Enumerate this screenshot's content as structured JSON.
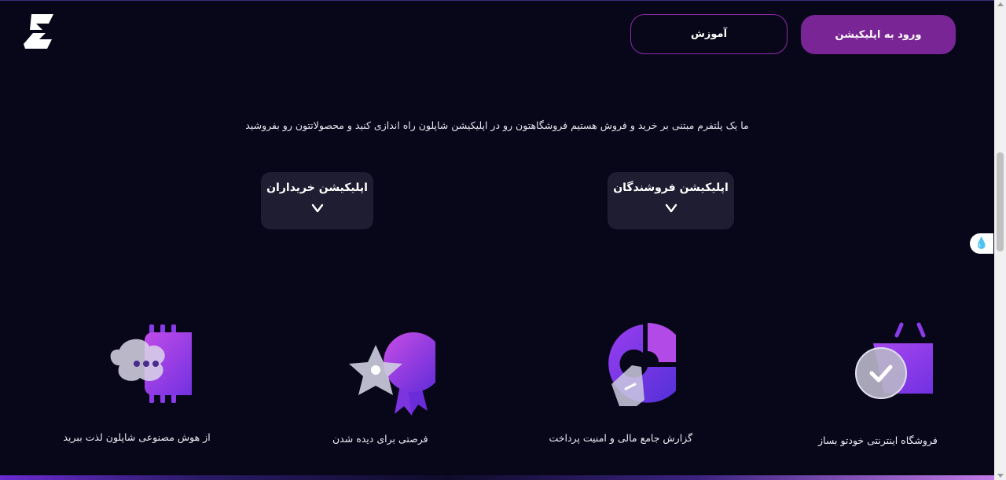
{
  "header": {
    "login_button": "ورود به اپلیکیشن",
    "learn_button": "آموزش"
  },
  "hero": {
    "tagline": "ما یک پلتفرم مبتنی بر خرید و فروش هستیم فروشگاهتون رو در اپلیکیشن شاپلون راه اندازی کنید و محصولاتتون رو بفروشید"
  },
  "apps": {
    "buyers_label": "اپلیکیشن خریداران",
    "sellers_label": "اپلیکیشن فروشندگان"
  },
  "features": [
    {
      "label": "از هوش مصنوعی شاپلون لذت ببرید",
      "icon": "ai-chip-chat-icon"
    },
    {
      "label": "فرصتی برای دیده شدن",
      "icon": "award-star-icon"
    },
    {
      "label": "گزارش جامع مالی و امنیت پرداخت",
      "icon": "pie-chart-report-icon"
    },
    {
      "label": "فروشگاه اینترنتی خودتو بساز",
      "icon": "shopping-basket-check-icon"
    }
  ],
  "colors": {
    "background": "#080719",
    "accent": "#7a2596",
    "card": "#1f1d31"
  }
}
